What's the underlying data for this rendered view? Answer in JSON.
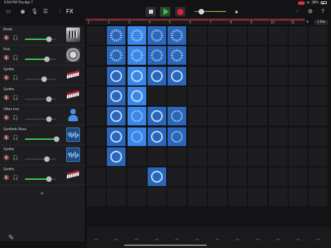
{
  "status": {
    "time": "6:54 PM",
    "date": "Thu Apr 7",
    "battery": "38%"
  },
  "toolbar": {
    "fx_label": "FX"
  },
  "ruler": {
    "bars": [
      "1",
      "2",
      "3",
      "4",
      "5",
      "6",
      "7",
      "8",
      "9",
      "10",
      "11"
    ],
    "bar_setting": "1 Bar"
  },
  "tracks": [
    {
      "name": "Beats",
      "instrument": "drum-machine",
      "muted": true,
      "volume": 0.75
    },
    {
      "name": "Kick",
      "instrument": "kick-drum",
      "muted": true,
      "volume": 0.7
    },
    {
      "name": "Synths",
      "instrument": "keyboard",
      "muted": true,
      "volume": 0.6
    },
    {
      "name": "Synths",
      "instrument": "keyboard",
      "muted": true,
      "volume": 0.75
    },
    {
      "name": "Other Inst",
      "instrument": "person",
      "muted": true,
      "volume": 0.75
    },
    {
      "name": "Synthetic Bass",
      "instrument": "waveform",
      "muted": true,
      "volume": 1.0
    },
    {
      "name": "Synths",
      "instrument": "waveform",
      "muted": true,
      "volume": 0.7
    },
    {
      "name": "Synths",
      "instrument": "keyboard",
      "muted": false,
      "volume": 0.75
    }
  ],
  "cells": {
    "rows": 9,
    "cols": 12,
    "active": [
      [
        1,
        2,
        3,
        4
      ],
      [
        1,
        2,
        3,
        4
      ],
      [
        1,
        2,
        3,
        4
      ],
      [
        1,
        2
      ],
      [
        1,
        2,
        3,
        4
      ],
      [
        1,
        2,
        3,
        4
      ],
      [
        1
      ],
      [
        3
      ],
      []
    ],
    "playing": [
      [
        0,
        2
      ],
      [
        1,
        2
      ],
      [
        2,
        2
      ],
      [
        3,
        2
      ],
      [
        4,
        2
      ],
      [
        5,
        2
      ]
    ]
  },
  "colors": {
    "accent_blue": "#3d7be0",
    "cell_on": "#2b66b8",
    "record_red": "#e3242f",
    "play_green": "#39c24a",
    "volume_green": "#3fcf4f",
    "ruler_red": "#7b2b35"
  }
}
